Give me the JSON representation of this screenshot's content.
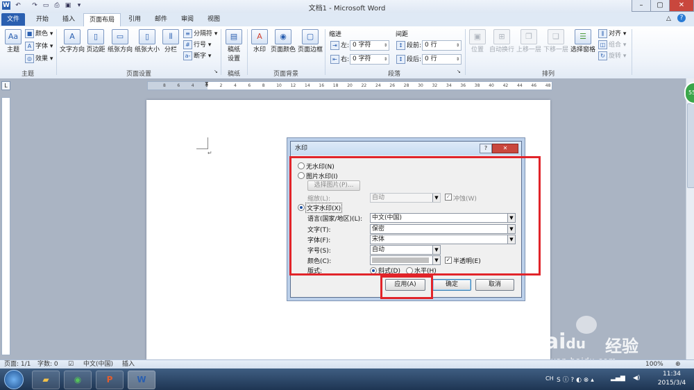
{
  "window": {
    "title": "文档1 - Microsoft Word"
  },
  "tabs": [
    "文件",
    "开始",
    "插入",
    "页面布局",
    "引用",
    "邮件",
    "审阅",
    "视图"
  ],
  "ribbon": {
    "theme": {
      "big": "主题",
      "colors": "颜色",
      "fonts": "字体",
      "effects": "效果",
      "group": "主题"
    },
    "page_setup": {
      "text_dir": "文字方向",
      "margins": "页边距",
      "orientation": "纸张方向",
      "size": "纸张大小",
      "columns": "分栏",
      "breaks": "分隔符",
      "line_numbers": "行号",
      "hyphenation": "断字",
      "group": "页面设置"
    },
    "manuscript": {
      "big_l1": "稿纸",
      "big_l2": "设置",
      "group": "稿纸"
    },
    "page_background": {
      "watermark": "水印",
      "page_color": "页面颜色",
      "page_border": "页面边框",
      "group": "页面背景"
    },
    "paragraph": {
      "indent": "缩进",
      "left": "左:",
      "right": "右:",
      "left_val": "0 字符",
      "right_val": "0 字符",
      "spacing": "间距",
      "before": "段前:",
      "after": "段后:",
      "before_val": "0 行",
      "after_val": "0 行",
      "group": "段落"
    },
    "arrange": {
      "position": "位置",
      "wrap": "自动换行",
      "forward": "上移一层",
      "backward": "下移一层",
      "selection_pane": "选择窗格",
      "align": "对齐",
      "group_obj": "组合",
      "rotate": "旋转",
      "group": "排列"
    }
  },
  "ruler_ticks": [
    "8",
    "6",
    "4",
    "2",
    "2",
    "4",
    "6",
    "8",
    "10",
    "12",
    "14",
    "16",
    "18",
    "20",
    "22",
    "24",
    "26",
    "28",
    "30",
    "32",
    "34",
    "36",
    "38",
    "40",
    "42",
    "44",
    "46",
    "48"
  ],
  "dialog": {
    "title": "水印",
    "no_watermark": "无水印(N)",
    "picture_watermark": "图片水印(I)",
    "select_picture": "选择图片(P)...",
    "scale_label": "缩放(L):",
    "scale_value": "自动",
    "washout": "冲蚀(W)",
    "text_watermark": "文字水印(X)",
    "language_label": "语言(国家/地区)(L):",
    "language_value": "中文(中国)",
    "text_label": "文字(T):",
    "text_value": "保密",
    "font_label": "字体(F):",
    "font_value": "宋体",
    "size_label": "字号(S):",
    "size_value": "自动",
    "color_label": "颜色(C):",
    "semitransparent": "半透明(E)",
    "layout_label": "版式:",
    "diagonal": "斜式(D)",
    "horizontal": "水平(H)",
    "apply": "应用(A)",
    "ok": "确定",
    "cancel": "取消"
  },
  "status": {
    "page": "页面: 1/1",
    "words": "字数: 0",
    "language": "中文(中国)",
    "mode": "插入",
    "zoom": "100%"
  },
  "taskbar": {
    "time": "11:34",
    "date": "2015/3/4",
    "lang": "CH"
  },
  "watermark_brand": {
    "logo": "Bai",
    "logo2": "du",
    "cn": "经验",
    "url": "jingyan.baidu.com"
  },
  "colors": {
    "highlight": "#e1242a",
    "file_tab": "#2a5fb0"
  }
}
